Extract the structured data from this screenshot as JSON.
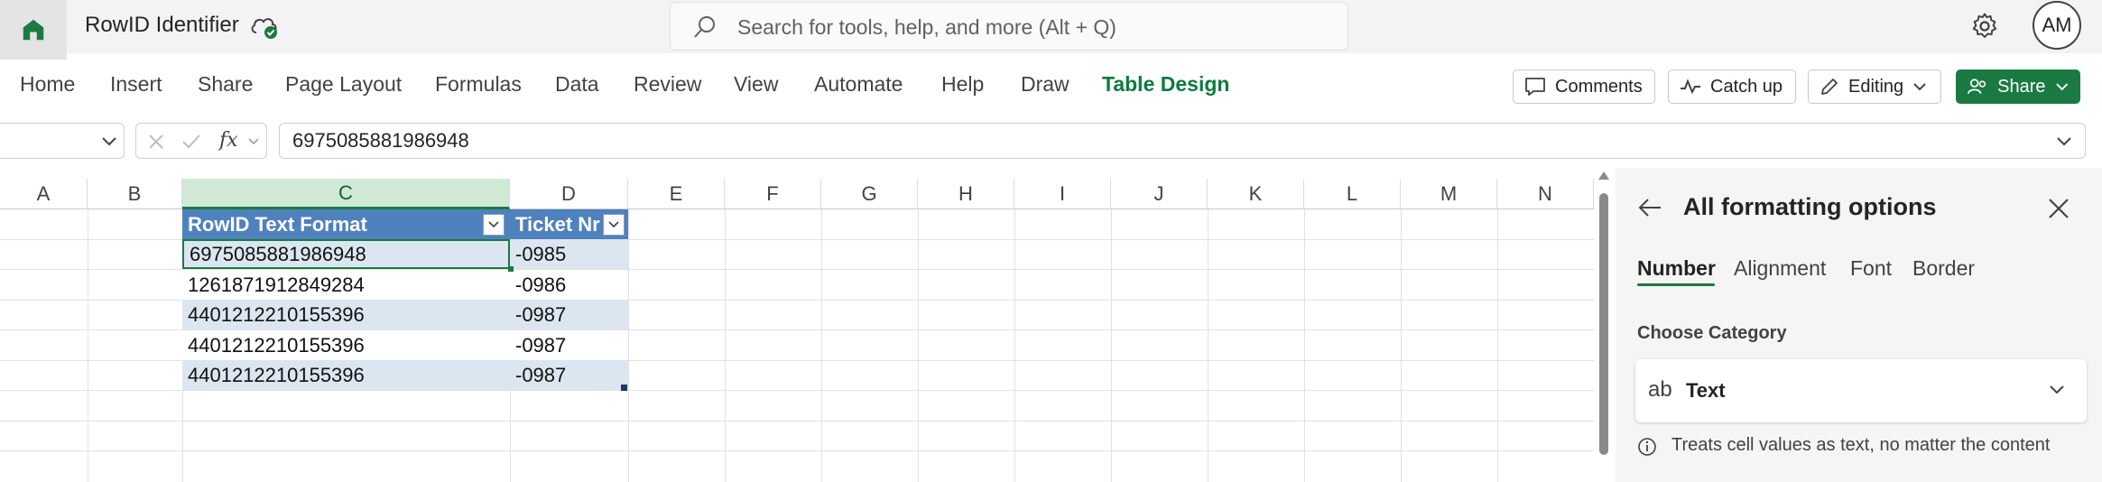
{
  "titlebar": {
    "doc_title": "RowID Identifier",
    "search_placeholder": "Search for tools, help, and more (Alt + Q)",
    "avatar_initials": "AM"
  },
  "ribbon": {
    "tabs": [
      "Home",
      "Insert",
      "Share",
      "Page Layout",
      "Formulas",
      "Data",
      "Review",
      "View",
      "Automate",
      "Help",
      "Draw",
      "Table Design"
    ],
    "active_tab": "Table Design",
    "comments": "Comments",
    "catch_up": "Catch up",
    "editing": "Editing",
    "share": "Share"
  },
  "formula_bar": {
    "value": "6975085881986948",
    "fx": "fx"
  },
  "grid": {
    "columns": [
      "A",
      "B",
      "C",
      "D",
      "E",
      "F",
      "G",
      "H",
      "I",
      "J",
      "K",
      "L",
      "M",
      "N"
    ],
    "selected_column": "C",
    "table_headers": [
      "RowID Text Format",
      "Ticket Nr"
    ],
    "rows": [
      [
        "6975085881986948",
        "-0985"
      ],
      [
        "1261871912849284",
        "-0986"
      ],
      [
        "4401212210155396",
        "-0987"
      ],
      [
        "4401212210155396",
        "-0987"
      ],
      [
        "4401212210155396",
        "-0987"
      ]
    ]
  },
  "panel": {
    "title": "All formatting options",
    "tabs": [
      "Number",
      "Alignment",
      "Font",
      "Border"
    ],
    "active_tab": "Number",
    "choose_label": "Choose Category",
    "category_icon": "ab",
    "category": "Text",
    "info": "Treats cell values as text, no matter the content"
  },
  "colors": {
    "accent": "#1b7a42",
    "table_header": "#4f81bd",
    "table_band": "#dce6f1"
  }
}
